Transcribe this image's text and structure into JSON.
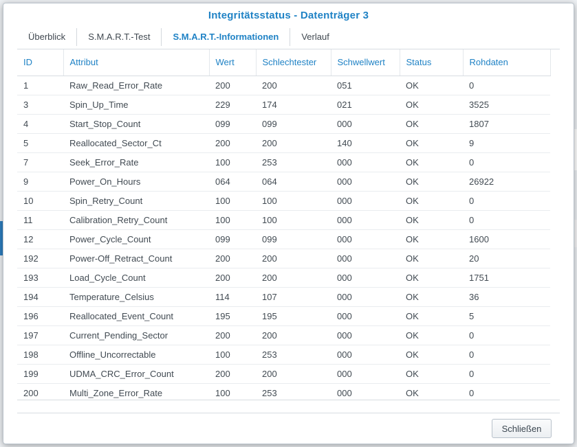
{
  "dialog": {
    "title": "Integritätsstatus - Datenträger 3",
    "close_label": "Schließen"
  },
  "tabs": [
    {
      "label": "Überblick",
      "active": false
    },
    {
      "label": "S.M.A.R.T.-Test",
      "active": false
    },
    {
      "label": "S.M.A.R.T.-Informationen",
      "active": true
    },
    {
      "label": "Verlauf",
      "active": false
    }
  ],
  "table": {
    "headers": [
      "ID",
      "Attribut",
      "Wert",
      "Schlechtester",
      "Schwellwert",
      "Status",
      "Rohdaten"
    ],
    "rows": [
      [
        "1",
        "Raw_Read_Error_Rate",
        "200",
        "200",
        "051",
        "OK",
        "0"
      ],
      [
        "3",
        "Spin_Up_Time",
        "229",
        "174",
        "021",
        "OK",
        "3525"
      ],
      [
        "4",
        "Start_Stop_Count",
        "099",
        "099",
        "000",
        "OK",
        "1807"
      ],
      [
        "5",
        "Reallocated_Sector_Ct",
        "200",
        "200",
        "140",
        "OK",
        "9"
      ],
      [
        "7",
        "Seek_Error_Rate",
        "100",
        "253",
        "000",
        "OK",
        "0"
      ],
      [
        "9",
        "Power_On_Hours",
        "064",
        "064",
        "000",
        "OK",
        "26922"
      ],
      [
        "10",
        "Spin_Retry_Count",
        "100",
        "100",
        "000",
        "OK",
        "0"
      ],
      [
        "11",
        "Calibration_Retry_Count",
        "100",
        "100",
        "000",
        "OK",
        "0"
      ],
      [
        "12",
        "Power_Cycle_Count",
        "099",
        "099",
        "000",
        "OK",
        "1600"
      ],
      [
        "192",
        "Power-Off_Retract_Count",
        "200",
        "200",
        "000",
        "OK",
        "20"
      ],
      [
        "193",
        "Load_Cycle_Count",
        "200",
        "200",
        "000",
        "OK",
        "1751"
      ],
      [
        "194",
        "Temperature_Celsius",
        "114",
        "107",
        "000",
        "OK",
        "36"
      ],
      [
        "196",
        "Reallocated_Event_Count",
        "195",
        "195",
        "000",
        "OK",
        "5"
      ],
      [
        "197",
        "Current_Pending_Sector",
        "200",
        "200",
        "000",
        "OK",
        "0"
      ],
      [
        "198",
        "Offline_Uncorrectable",
        "100",
        "253",
        "000",
        "OK",
        "0"
      ],
      [
        "199",
        "UDMA_CRC_Error_Count",
        "200",
        "200",
        "000",
        "OK",
        "0"
      ],
      [
        "200",
        "Multi_Zone_Error_Rate",
        "100",
        "253",
        "000",
        "OK",
        "0"
      ]
    ]
  },
  "colors": {
    "accent": "#1f82c5",
    "text": "#414a52"
  }
}
